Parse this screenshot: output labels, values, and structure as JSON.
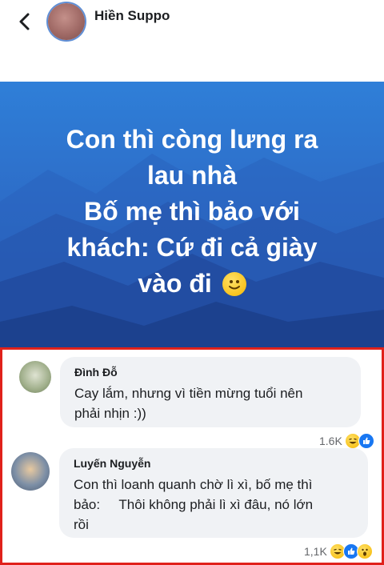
{
  "header": {
    "author_name": "Hiền Suppo"
  },
  "post": {
    "lines": [
      "Con thì còng lưng ra",
      "lau nhà",
      "Bố mẹ thì bảo với",
      "khách: Cứ đi cả giày",
      "vào đi"
    ],
    "background_color": "#2d6dc8",
    "emoji": "slightly-smiling-face"
  },
  "comments": [
    {
      "name": "Đình Đỗ",
      "text_lines": [
        "Cay lắm, nhưng vì tiền mừng tuổi nên",
        "phải nhịn :))"
      ],
      "reaction_count": "1.6K",
      "reactions": [
        "haha",
        "like"
      ]
    },
    {
      "name": "Luyến Nguyễn",
      "text_lines": [
        "Con thì loanh quanh chờ lì xì, bố mẹ thì",
        "bảo:     Thôi không phải lì xì đâu, nó lớn",
        "rồi"
      ],
      "reaction_count": "1,1K",
      "reactions": [
        "haha",
        "like",
        "wow"
      ]
    }
  ],
  "highlight_color": "#e0211b"
}
